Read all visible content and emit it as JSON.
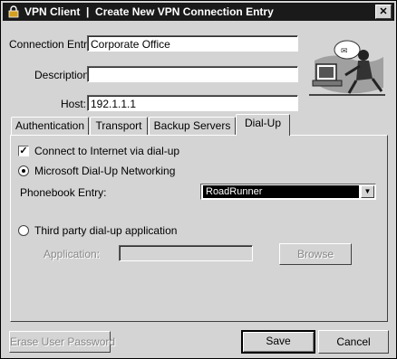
{
  "window": {
    "title": "VPN Client  |  Create New VPN Connection Entry",
    "close_glyph": "✕"
  },
  "form": {
    "connection_entry_label": "Connection Entry:",
    "connection_entry_value": "Corporate Office",
    "description_label": "Description:",
    "description_value": "",
    "host_label": "Host:",
    "host_value": "192.1.1.1"
  },
  "tabs": [
    {
      "label": "Authentication",
      "active": false
    },
    {
      "label": "Transport",
      "active": false
    },
    {
      "label": "Backup Servers",
      "active": false
    },
    {
      "label": "Dial-Up",
      "active": true
    }
  ],
  "dialup": {
    "connect_via_dialup_label": "Connect to Internet via dial-up",
    "connect_via_dialup_checked": true,
    "microsoft_dun_label": "Microsoft Dial-Up Networking",
    "microsoft_dun_selected": true,
    "phonebook_label": "Phonebook Entry:",
    "phonebook_value": "RoadRunner",
    "third_party_label": "Third party dial-up application",
    "third_party_selected": false,
    "application_label": "Application:",
    "application_value": "",
    "browse_label": "Browse"
  },
  "footer": {
    "erase_password_label": "Erase User Password",
    "save_label": "Save",
    "cancel_label": "Cancel"
  }
}
